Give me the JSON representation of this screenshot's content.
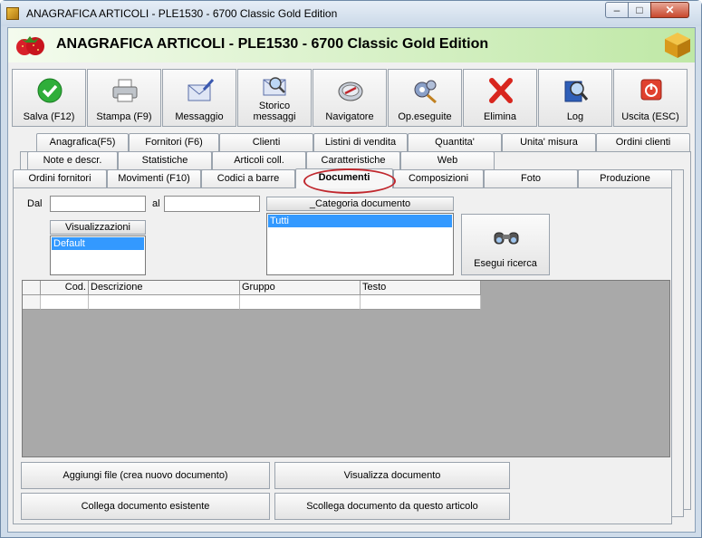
{
  "window": {
    "title": "ANAGRAFICA ARTICOLI - PLE1530 - 6700 Classic Gold Edition",
    "minimize_glyph": "–",
    "maximize_glyph": "□",
    "close_glyph": "✕"
  },
  "header": {
    "title": "ANAGRAFICA ARTICOLI - PLE1530 - 6700 Classic Gold Edition",
    "logo_icon": "strawberry-icon",
    "right_icon": "package-cube-icon"
  },
  "toolbar": {
    "buttons": [
      {
        "label": "Salva (F12)",
        "icon": "checkmark-icon"
      },
      {
        "label": "Stampa (F9)",
        "icon": "printer-icon"
      },
      {
        "label": "Messaggio",
        "icon": "envelope-pen-icon"
      },
      {
        "label": "Storico messaggi",
        "icon": "envelope-search-icon"
      },
      {
        "label": "Navigatore",
        "icon": "compass-icon"
      },
      {
        "label": "Op.eseguite",
        "icon": "gears-search-icon"
      },
      {
        "label": "Elimina",
        "icon": "red-x-icon"
      },
      {
        "label": "Log",
        "icon": "book-search-icon"
      },
      {
        "label": "Uscita (ESC)",
        "icon": "power-icon"
      }
    ]
  },
  "tabs": {
    "row1": [
      "Anagrafica(F5)",
      "Fornitori (F6)",
      "Clienti",
      "Listini di vendita",
      "Quantita'",
      "Unita' misura",
      "Ordini clienti"
    ],
    "row2": [
      "Note e descr.",
      "Statistiche",
      "Articoli coll.",
      "Caratteristiche",
      "Web"
    ],
    "row3": [
      "Ordini fornitori",
      "Movimenti (F10)",
      "Codici a barre",
      "Documenti",
      "Composizioni",
      "Foto",
      "Produzione"
    ],
    "active": "Documenti"
  },
  "documenti": {
    "dal_label": "Dal",
    "dal_value": "",
    "al_label": "al",
    "al_value": "",
    "visualizzazioni_label": "Visualizzazioni",
    "visualizzazioni_selected": "Default",
    "categoria_label": "_Categoria documento",
    "categoria_selected": "Tutti",
    "search_label": "Esegui ricerca",
    "search_icon": "binoculars-icon",
    "grid_columns": [
      "Cod.",
      "Descrizione",
      "Gruppo",
      "Testo"
    ],
    "buttons": {
      "add_file": "Aggiungi file (crea nuovo documento)",
      "view_doc": "Visualizza documento",
      "link_doc": "Collega documento esistente",
      "unlink_doc": "Scollega documento da questo articolo"
    }
  }
}
